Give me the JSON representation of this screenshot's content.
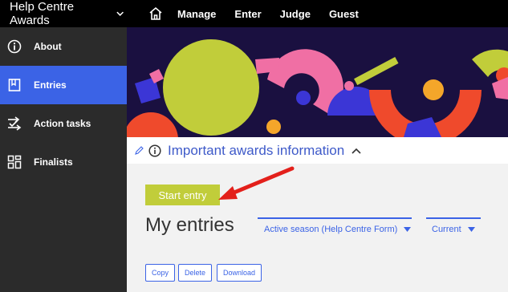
{
  "topbar": {
    "brand": "Help Centre Awards",
    "nav": [
      "Manage",
      "Enter",
      "Judge",
      "Guest"
    ]
  },
  "sidebar": {
    "items": [
      {
        "label": "About",
        "icon": "info-circle-icon",
        "active": false
      },
      {
        "label": "Entries",
        "icon": "bookmark-icon",
        "active": true
      },
      {
        "label": "Action tasks",
        "icon": "action-tasks-icon",
        "active": false
      },
      {
        "label": "Finalists",
        "icon": "grid-icon",
        "active": false
      }
    ]
  },
  "info": {
    "title": "Important awards information"
  },
  "main": {
    "start_entry": "Start entry",
    "heading": "My entries",
    "season_filter": "Active season (Help Centre Form)",
    "status_filter": "Current",
    "actions": [
      "Copy",
      "Delete",
      "Download"
    ]
  },
  "colors": {
    "accent": "#3b63e6",
    "start_button": "#c1cd3a",
    "banner_bg": "#1a1040",
    "arrow": "#e3201b"
  }
}
